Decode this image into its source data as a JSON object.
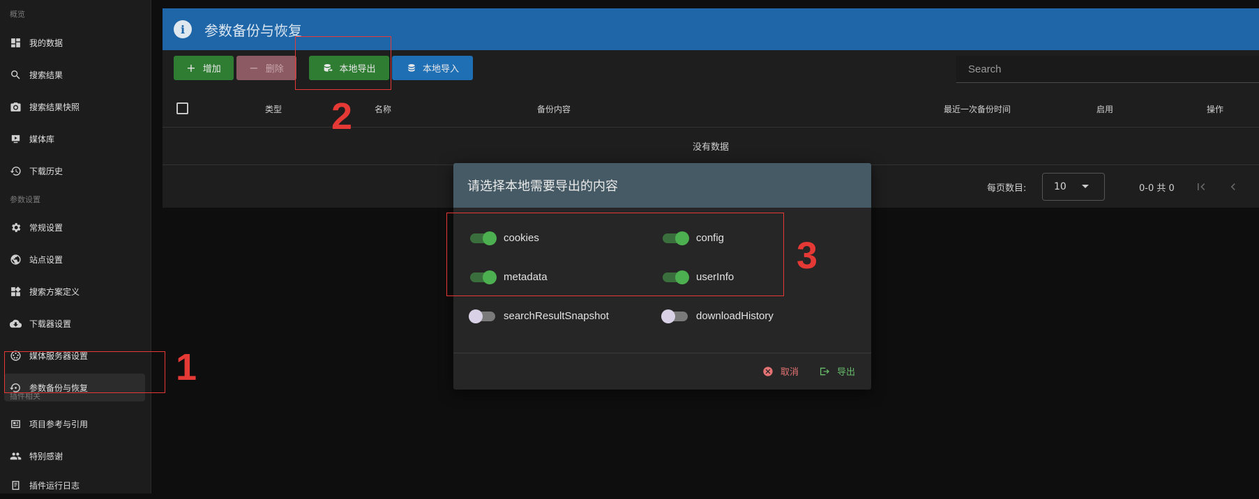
{
  "sidebar": {
    "sections": [
      "概览",
      "参数设置",
      "插件相关"
    ],
    "items": [
      {
        "label": "我的数据",
        "icon": "dashboard-icon"
      },
      {
        "label": "搜索结果",
        "icon": "search-icon"
      },
      {
        "label": "搜索结果快照",
        "icon": "camera-icon"
      },
      {
        "label": "媒体库",
        "icon": "media-library-icon"
      },
      {
        "label": "下载历史",
        "icon": "history-icon"
      },
      {
        "label": "常规设置",
        "icon": "gear-icon"
      },
      {
        "label": "站点设置",
        "icon": "globe-icon"
      },
      {
        "label": "搜索方案定义",
        "icon": "widgets-icon"
      },
      {
        "label": "下载器设置",
        "icon": "cloud-download-icon"
      },
      {
        "label": "媒体服务器设置",
        "icon": "server-icon"
      },
      {
        "label": "参数备份与恢复",
        "icon": "backup-restore-icon"
      },
      {
        "label": "项目参考与引用",
        "icon": "newspaper-icon"
      },
      {
        "label": "特别感谢",
        "icon": "people-icon"
      },
      {
        "label": "插件运行日志",
        "icon": "log-icon"
      }
    ]
  },
  "header": {
    "title": "参数备份与恢复"
  },
  "toolbar": {
    "add": "增加",
    "delete": "删除",
    "export": "本地导出",
    "import": "本地导入"
  },
  "search": {
    "placeholder": "Search"
  },
  "table": {
    "columns": [
      "类型",
      "名称",
      "备份内容",
      "最近一次备份时间",
      "启用",
      "操作"
    ],
    "empty": "没有数据"
  },
  "pagination": {
    "per_page_label": "每页数目:",
    "per_page": "10",
    "range": "0-0 共 0"
  },
  "modal": {
    "title": "请选择本地需要导出的内容",
    "options": [
      {
        "label": "cookies",
        "on": true
      },
      {
        "label": "config",
        "on": true
      },
      {
        "label": "metadata",
        "on": true
      },
      {
        "label": "userInfo",
        "on": true
      },
      {
        "label": "searchResultSnapshot",
        "on": false
      },
      {
        "label": "downloadHistory",
        "on": false
      }
    ],
    "cancel": "取消",
    "export": "导出"
  },
  "annotations": [
    "1",
    "2",
    "3"
  ],
  "colors": {
    "header": "#1f66a8",
    "green": "#2e7d32",
    "blue": "#1f6fb5",
    "annotation": "#e53935"
  }
}
